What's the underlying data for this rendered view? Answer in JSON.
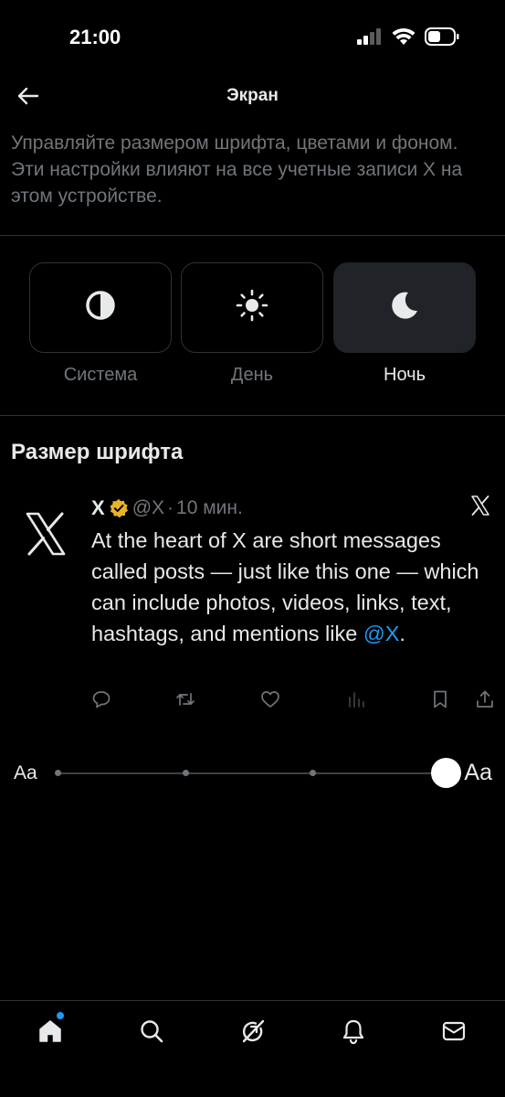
{
  "status_bar": {
    "time": "21:00"
  },
  "header": {
    "title": "Экран"
  },
  "description": "Управляйте размером шрифта, цветами и фоном. Эти настройки влияют на все учетные записи X на этом устройстве.",
  "themes": [
    {
      "label": "Система",
      "icon": "half-circle-icon",
      "selected": false
    },
    {
      "label": "День",
      "icon": "sun-icon",
      "selected": false
    },
    {
      "label": "Ночь",
      "icon": "moon-icon",
      "selected": true
    }
  ],
  "font_size": {
    "title": "Размер шрифта",
    "small_label": "Aa",
    "large_label": "Aa",
    "steps": 5,
    "selected_step": 5
  },
  "preview_post": {
    "name": "X",
    "handle": "@X",
    "separator": "·",
    "time": "10 мин.",
    "text": "At the heart of X are short messages called posts — just like this one — which can include photos, videos, links, text, hashtags, and mentions like ",
    "mention": "@X",
    "text_end": "."
  },
  "colors": {
    "background": "#000000",
    "accent": "#1d9bf0",
    "verified_badge": "#e8b327",
    "secondary_text": "#71767b"
  },
  "tabbar": {
    "items": [
      "home-icon",
      "search-icon",
      "grok-icon",
      "notifications-icon",
      "messages-icon"
    ]
  }
}
